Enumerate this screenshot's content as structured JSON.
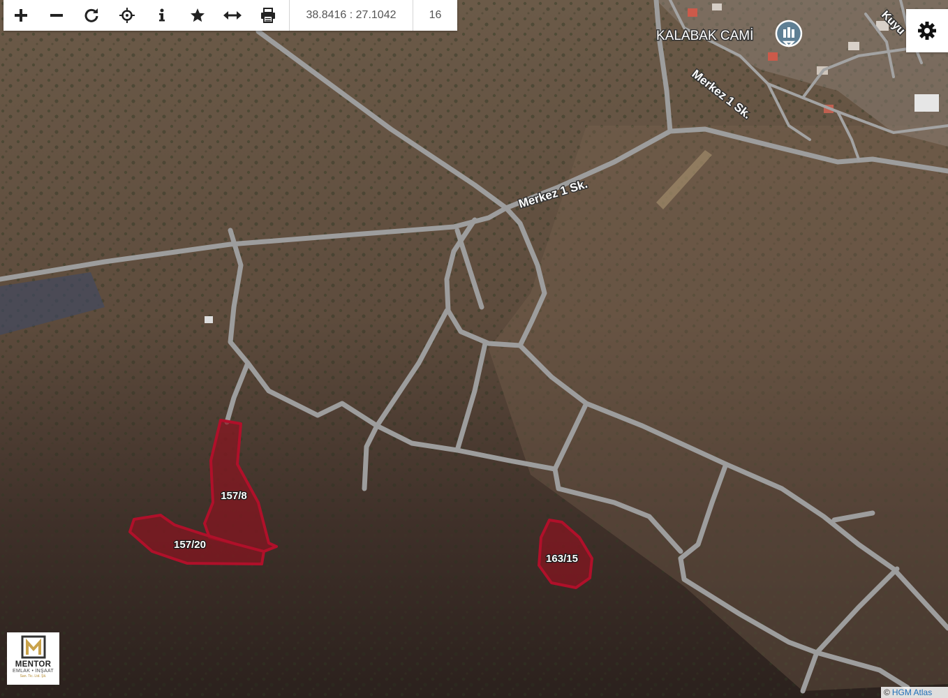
{
  "toolbar": {
    "coordinates": "38.8416 : 27.1042",
    "zoom_level": "16"
  },
  "map_labels": {
    "poi_name": "KALABAK CAMİ",
    "street_main": "Merkez 1 Sk.",
    "street_diag": "Merkez 1 Sk.",
    "street_partial": "Kuyu"
  },
  "parcels": [
    {
      "label": "157/8"
    },
    {
      "label": "157/20"
    },
    {
      "label": "163/15"
    }
  ],
  "logo": {
    "name": "MENTOR",
    "sub": "EMLAK • İNŞAAT",
    "sub2": "San. Tic. Ltd. Şti."
  },
  "attribution": {
    "prefix": "©",
    "link": "HGM Atlas"
  },
  "colors": {
    "parcel_fill": "#8a1420",
    "parcel_stroke": "#b0102a",
    "road": "#9d9d9d"
  }
}
